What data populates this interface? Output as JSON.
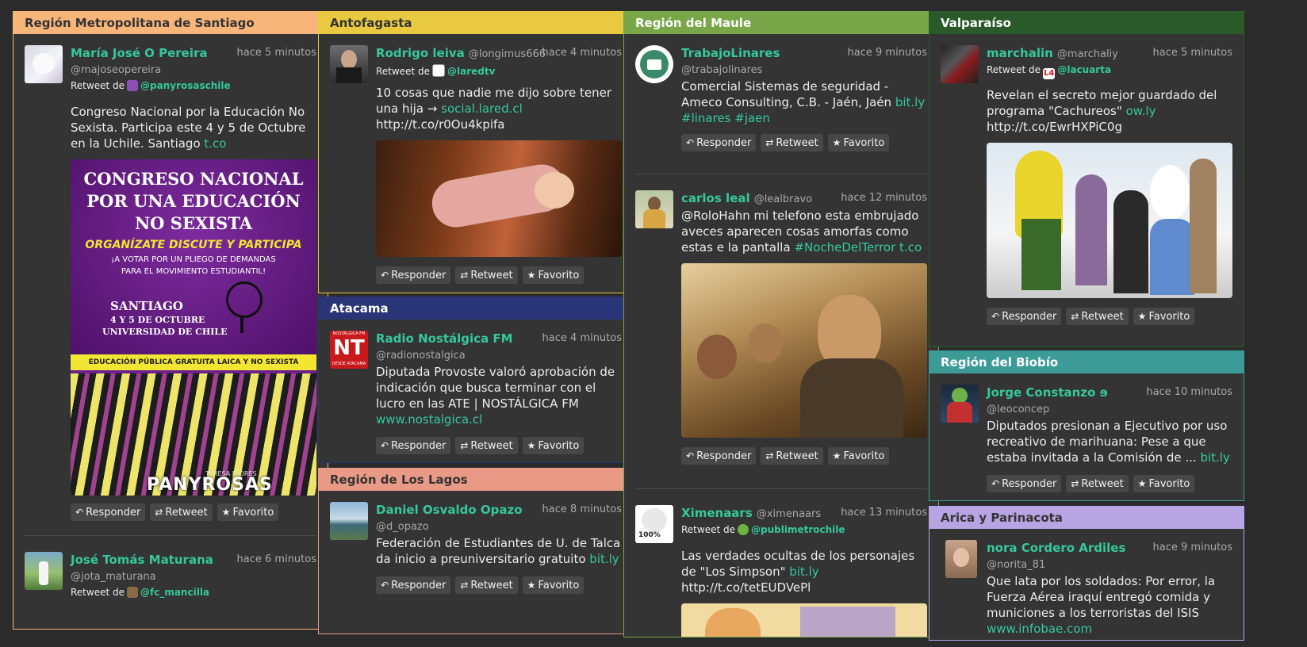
{
  "columns": [
    {
      "panels": [
        {
          "title": "Región Metropolitana de Santiago",
          "tweets": [
            {
              "name": "María José O Pereira",
              "handle": "@majoseopereira",
              "time": "hace 5 minutos",
              "retweet_prefix": "Retweet de",
              "retweet_user": "@panyrosaschile",
              "text": "Congreso Nacional por la Educación No Sexista. Participa este 4 y 5 de Octubre en la Uchile. Santiago",
              "link": "t.co",
              "poster": {
                "line1": "CONGRESO NACIONAL",
                "line2": "POR UNA EDUCACIÓN",
                "line3": "NO SEXISTA",
                "slogan": "ORGANÍZATE DISCUTE Y PARTICIPA",
                "sub1": "¡A VOTAR POR UN PLIEGO DE DEMANDAS",
                "sub2": "PARA EL MOVIMIENTO ESTUDIANTIL!",
                "city": "SANTIAGO",
                "dates": "4 Y 5 DE OCTUBRE",
                "venue": "UNIVERSIDAD DE CHILE",
                "banner": "EDUCACIÓN PÚBLICA GRATUITA LAICA Y NO SEXISTA",
                "brand": "PANYROSAS",
                "brand_small": "TERESA FLORES"
              }
            },
            {
              "name": "José Tomás Maturana",
              "handle": "@jota_maturana",
              "time": "hace 6 minutos",
              "retweet_prefix": "Retweet de",
              "retweet_user": "@fc_mancilla"
            }
          ]
        }
      ]
    },
    {
      "panels": [
        {
          "title": "Antofagasta",
          "tweets": [
            {
              "name": "Rodrigo leiva",
              "handle": "@longimus666",
              "time": "hace 4 minutos",
              "retweet_prefix": "Retweet de",
              "retweet_user": "@laredtv",
              "text": "10 cosas que nadie me dijo sobre tener una hija →",
              "link": "social.lared.cl",
              "tail": "http://t.co/r0Ou4kpifa"
            }
          ]
        },
        {
          "title": "Atacama",
          "tweets": [
            {
              "name": "Radio Nostálgica FM",
              "handle": "@radionostalgica",
              "time": "hace 4 minutos",
              "avatar_text": "NT",
              "avatar_top": "NOSTÁLGICA FM",
              "avatar_bottom": "DESDE ATACAMA",
              "text": "Diputada Provoste valoró aprobación de indicación que busca terminar con el lucro en las ATE | NOSTÁLGICA FM",
              "link": "www.nostalgica.cl"
            }
          ]
        },
        {
          "title": "Región de Los Lagos",
          "tweets": [
            {
              "name": "Daniel Osvaldo Opazo",
              "handle": "@d_opazo",
              "time": "hace 8 minutos",
              "text": "Federación de Estudiantes de U. de Talca da inicio a preuniversitario gratuito",
              "link": "bit.ly"
            }
          ]
        }
      ]
    },
    {
      "panels": [
        {
          "title": "Región del Maule",
          "tweets": [
            {
              "name": "TrabajoLinares",
              "handle": "@trabajolinares",
              "time": "hace 9 minutos",
              "text": "Comercial Sistemas de seguridad - Ameco Consulting, C.B. - Jaén, Jaén",
              "link": "bit.ly",
              "tags": "#linares #jaen"
            },
            {
              "name": "carlos leal",
              "handle": "@lealbravo",
              "time": "hace 12 minutos",
              "text": "@RoloHahn mi telefono esta embrujado aveces aparecen cosas amorfas como estas e la pantalla",
              "tags": "#NocheDelTerror",
              "link": "t.co"
            },
            {
              "name": "Ximenaars",
              "handle": "@ximenaars",
              "time": "hace 13 minutos",
              "avatar_text": "100%",
              "retweet_prefix": "Retweet de",
              "retweet_user": "@publimetrochile",
              "text": "Las verdades ocultas de los personajes de \"Los Simpson\"",
              "link": "bit.ly",
              "tail": "http://t.co/tetEUDVePl"
            }
          ]
        }
      ]
    },
    {
      "panels": [
        {
          "title": "Valparaíso",
          "tweets": [
            {
              "name": "marchalin",
              "handle": "@marchaliy",
              "time": "hace 5 minutos",
              "retweet_prefix": "Retweet de",
              "retweet_user": "@lacuarta",
              "retweet_badge": "L4",
              "text": "Revelan el secreto mejor guardado del programa \"Cachureos\"",
              "link": "ow.ly",
              "tail": "http://t.co/EwrHXPiC0g"
            }
          ]
        },
        {
          "title": "Región del Biobío",
          "tweets": [
            {
              "name": "Jorge Constanzo ɘ",
              "handle": "@leoconcep",
              "time": "hace 10 minutos",
              "text": "Diputados presionan a Ejecutivo por uso recreativo de marihuana: Pese a que estaba invitada a la Comisión de ...",
              "link": "bit.ly"
            }
          ]
        },
        {
          "title": "Arica y Parinacota",
          "tweets": [
            {
              "name": "nora Cordero Ardiles",
              "handle": "@norita_81",
              "time": "hace 9 minutos",
              "text": "Que lata por los soldados: Por error, la Fuerza Aérea iraquí entregó comida y municiones a los terroristas del ISIS",
              "link": "www.infobae.com"
            }
          ]
        }
      ]
    }
  ],
  "actions": {
    "reply": "Responder",
    "retweet": "Retweet",
    "favorite": "Favorito"
  },
  "colors": {
    "background": "#2b2b2b",
    "card": "#343434",
    "link": "#35c89a",
    "santiago": "#f7b57a",
    "antofagasta": "#e8c93f",
    "atacama": "#2a3577",
    "loslagos": "#e89a86",
    "maule": "#79a649",
    "valparaiso": "#2a5a2a",
    "biobio": "#3c9b97",
    "arica": "#b7a4e2"
  },
  "icons": {
    "reply": "reply-icon",
    "retweet": "retweet-icon",
    "favorite": "star-icon"
  }
}
